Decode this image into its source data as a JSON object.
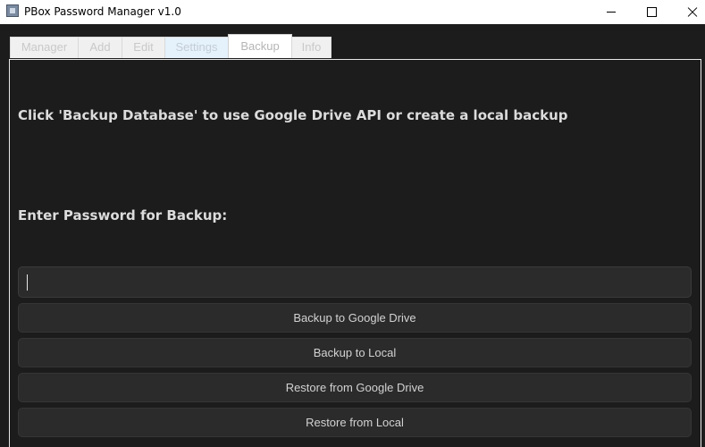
{
  "window": {
    "title": "PBox Password Manager v1.0",
    "icons": {
      "app": "app-icon",
      "minimize": "minimize-icon",
      "maximize": "maximize-icon",
      "close": "close-icon"
    }
  },
  "tabs": [
    {
      "label": "Manager",
      "active": false
    },
    {
      "label": "Add",
      "active": false
    },
    {
      "label": "Edit",
      "active": false
    },
    {
      "label": "Settings",
      "active": false
    },
    {
      "label": "Backup",
      "active": true
    },
    {
      "label": "Info",
      "active": false
    }
  ],
  "backup": {
    "instruction": "Click 'Backup Database' to use Google Drive API or create a local backup",
    "password_label": "Enter Password for Backup:",
    "password_value": "",
    "buttons": {
      "backup_google": "Backup to Google Drive",
      "backup_local": "Backup to Local",
      "restore_google": "Restore from Google Drive",
      "restore_local": "Restore from Local"
    }
  },
  "colors": {
    "background": "#1c1c1c",
    "button": "#2b2b2b",
    "text": "#d2d2d2",
    "heading": "#dcdcdc",
    "titlebar": "#ffffff"
  }
}
